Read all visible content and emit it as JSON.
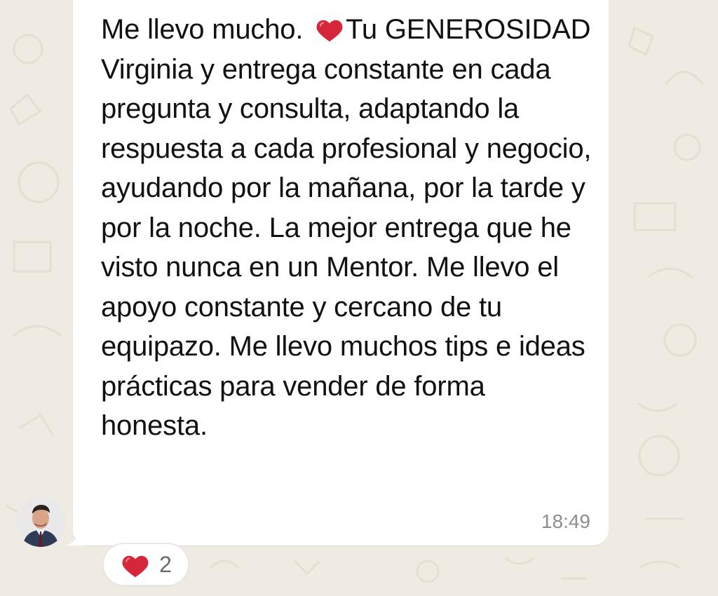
{
  "message": {
    "text_prefix": "Me llevo mucho. ",
    "text_after_emoji": "Tu GENEROSIDAD Virginia y entrega constante en cada pregunta y consulta, adaptando la respuesta a cada profesional y negocio, ayudando por la mañana, por la tarde y por la noche. La mejor entrega que he visto nunca en un Mentor. Me llevo el apoyo constante y cercano de tu equipazo. Me llevo muchos tips e ideas prácticas para vender de forma honesta.",
    "timestamp": "18:49",
    "inline_emoji": "red-heart-icon"
  },
  "reaction": {
    "emoji": "red-heart-icon",
    "count": "2"
  },
  "colors": {
    "background": "#efeae2",
    "bubble": "#ffffff",
    "heart": "#d6263a",
    "timestamp": "#8d8d8d"
  }
}
